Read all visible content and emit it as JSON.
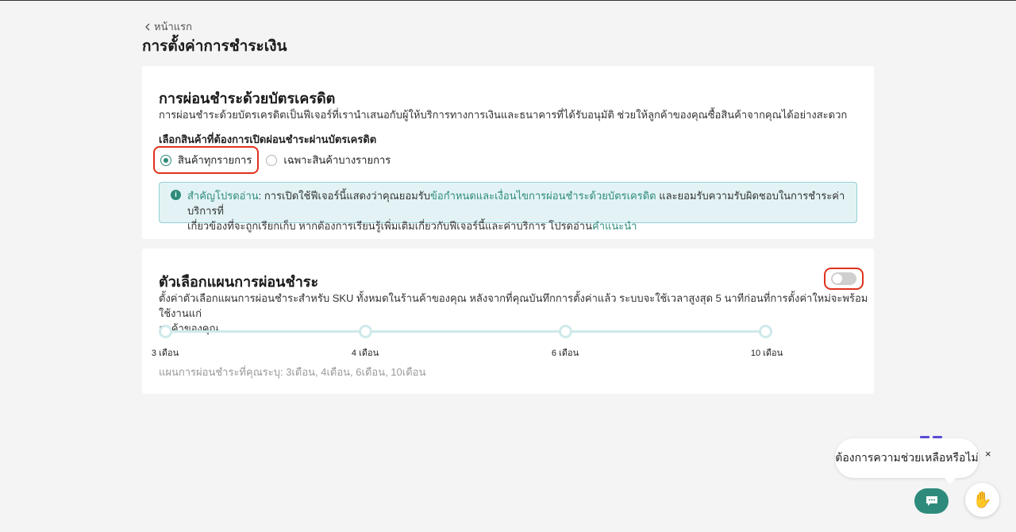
{
  "nav": {
    "back_label": "หน้าแรก"
  },
  "page": {
    "title": "การตั้งค่าการชำระเงิน"
  },
  "installment": {
    "title": "การผ่อนชำระด้วยบัตรเครดิต",
    "description": "การผ่อนชำระด้วยบัตรเครดิตเป็นฟีเจอร์ที่เรานำเสนอกับผู้ให้บริการทางการเงินและธนาคารที่ได้รับอนุมัติ ช่วยให้ลูกค้าของคุณซื้อสินค้าจากคุณได้อย่างสะดวก",
    "select_label": "เลือกสินค้าที่ต้องการเปิดผ่อนชำระผ่านบัตรเครดิต",
    "options": [
      {
        "label": "สินค้าทุกรายการ",
        "selected": true
      },
      {
        "label": "เฉพาะสินค้าบางรายการ",
        "selected": false
      }
    ],
    "notice": {
      "important": "สำคัญโปรดอ่าน",
      "text_1": ": การเปิดใช้ฟีเจอร์นี้แสดงว่าคุณยอมรับ",
      "link_terms": "ข้อกำหนดและเงื่อนไขการผ่อนชำระด้วยบัตรเครดิต",
      "text_2": " และยอมรับความรับผิดชอบในการชำระค่าบริการที่",
      "text_3": "เกี่ยวข้องที่จะถูกเรียกเก็บ หากต้องการเรียนรู้เพิ่มเติมเกี่ยวกับฟีเจอร์นี้และค่าบริการ โปรดอ่าน",
      "link_guide": "คำแนะนำ"
    }
  },
  "plan_options": {
    "title": "ตัวเลือกแผนการผ่อนชำระ",
    "toggle_on": false,
    "description_1": "ตั้งค่าตัวเลือกแผนการผ่อนชำระสำหรับ SKU ทั้งหมดในร้านค้าของคุณ หลังจากที่คุณบันทึกการตั้งค่าแล้ว ระบบจะใช้เวลาสูงสุด 5 นาทีก่อนที่การตั้งค่าใหม่จะพร้อมใช้งานแก่",
    "description_2": "ลูกค้าของคุณ",
    "terms": [
      "3 เดือน",
      "4 เดือน",
      "6 เดือน",
      "10 เดือน"
    ],
    "note": "แผนการผ่อนชำระที่คุณระบุ: 3เดือน, 4เดือน, 6เดือน, 10เดือน"
  },
  "help": {
    "bubble_text": "ต้องการความช่วยเหลือหรือไม่",
    "close": "×"
  },
  "colors": {
    "accent": "#2e8b7b",
    "highlight": "#e0321c",
    "notice_bg": "#e3f3f5"
  },
  "icons": [
    "chevron-left-icon",
    "info-icon",
    "chat-icon",
    "hand-icon",
    "close-icon"
  ]
}
